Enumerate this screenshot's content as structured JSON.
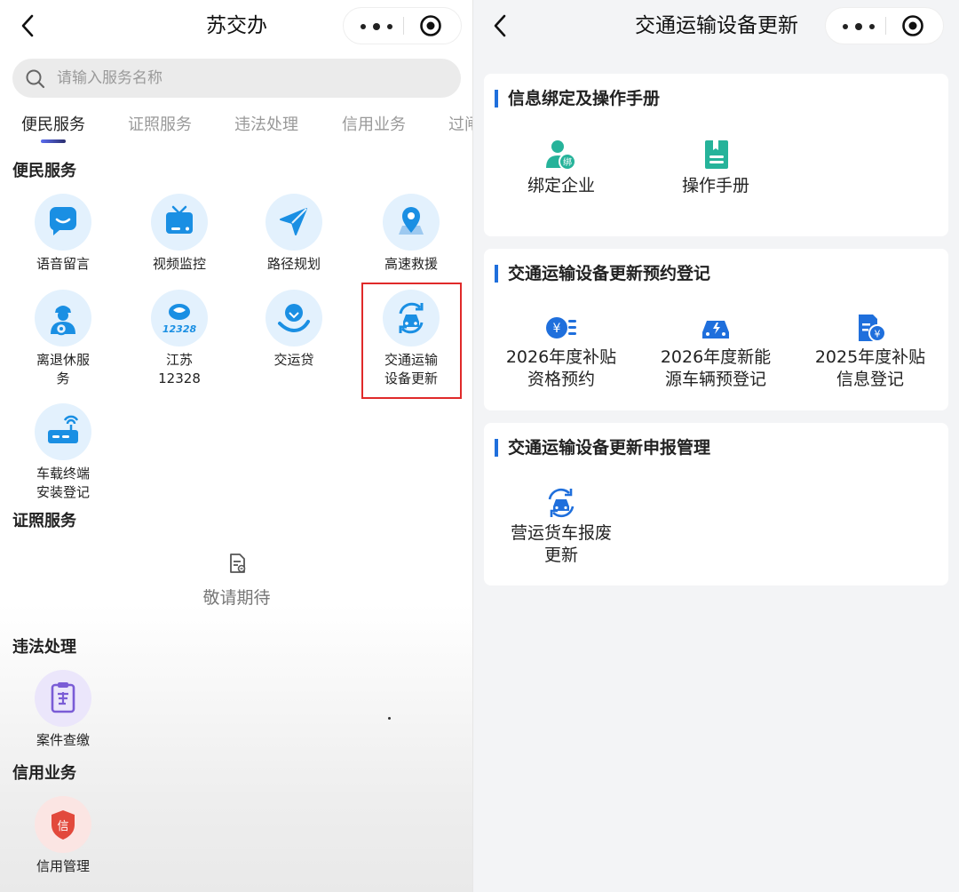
{
  "left": {
    "title": "苏交办",
    "search_placeholder": "请输入服务名称",
    "tabs": [
      "便民服务",
      "证照服务",
      "违法处理",
      "信用业务",
      "过闸"
    ],
    "sections": {
      "convenience": "便民服务",
      "license": "证照服务",
      "violation": "违法处理",
      "credit": "信用业务"
    },
    "services": [
      {
        "label": "语音留言",
        "icon": "speech-bubble-icon"
      },
      {
        "label": "视频监控",
        "icon": "tv-icon"
      },
      {
        "label": "路径规划",
        "icon": "navigation-arrow-icon"
      },
      {
        "label": "高速救援",
        "icon": "map-pin-icon"
      },
      {
        "label": "离退休服\n务",
        "icon": "retiree-icon"
      },
      {
        "label": "江苏\n12328",
        "icon": "hotline-12328-icon"
      },
      {
        "label": "交运贷",
        "icon": "loan-hand-icon"
      },
      {
        "label": "交通运输\n设备更新",
        "icon": "car-renew-icon"
      },
      {
        "label": "车载终端\n安装登记",
        "icon": "terminal-device-icon"
      }
    ],
    "coming_soon": "敬请期待",
    "violation_item": {
      "label": "案件查缴",
      "icon": "case-clipboard-icon"
    },
    "credit_item": {
      "label": "信用管理",
      "icon": "credit-shield-icon",
      "glyph": "信"
    }
  },
  "right": {
    "title": "交通运输设备更新",
    "cards": [
      {
        "title": "信息绑定及操作手册",
        "items": [
          {
            "label": "绑定企业",
            "icon": "bind-enterprise-icon",
            "glyph": "绑"
          },
          {
            "label": "操作手册",
            "icon": "manual-book-icon"
          }
        ]
      },
      {
        "title": "交通运输设备更新预约登记",
        "items": [
          {
            "label": "2026年度补贴\n资格预约",
            "icon": "subsidy-yen-icon"
          },
          {
            "label": "2026年度新能\n源车辆预登记",
            "icon": "new-energy-car-icon"
          },
          {
            "label": "2025年度补贴\n信息登记",
            "icon": "document-yen-icon"
          }
        ]
      },
      {
        "title": "交通运输设备更新申报管理",
        "items": [
          {
            "label": "营运货车报废\n更新",
            "icon": "truck-scrap-renew-icon"
          }
        ]
      }
    ]
  },
  "colors": {
    "accent_blue": "#1f6fdc",
    "green": "#26b39a",
    "highlight_red": "#e02a2a",
    "icon_blue": "#1a8fe3"
  }
}
